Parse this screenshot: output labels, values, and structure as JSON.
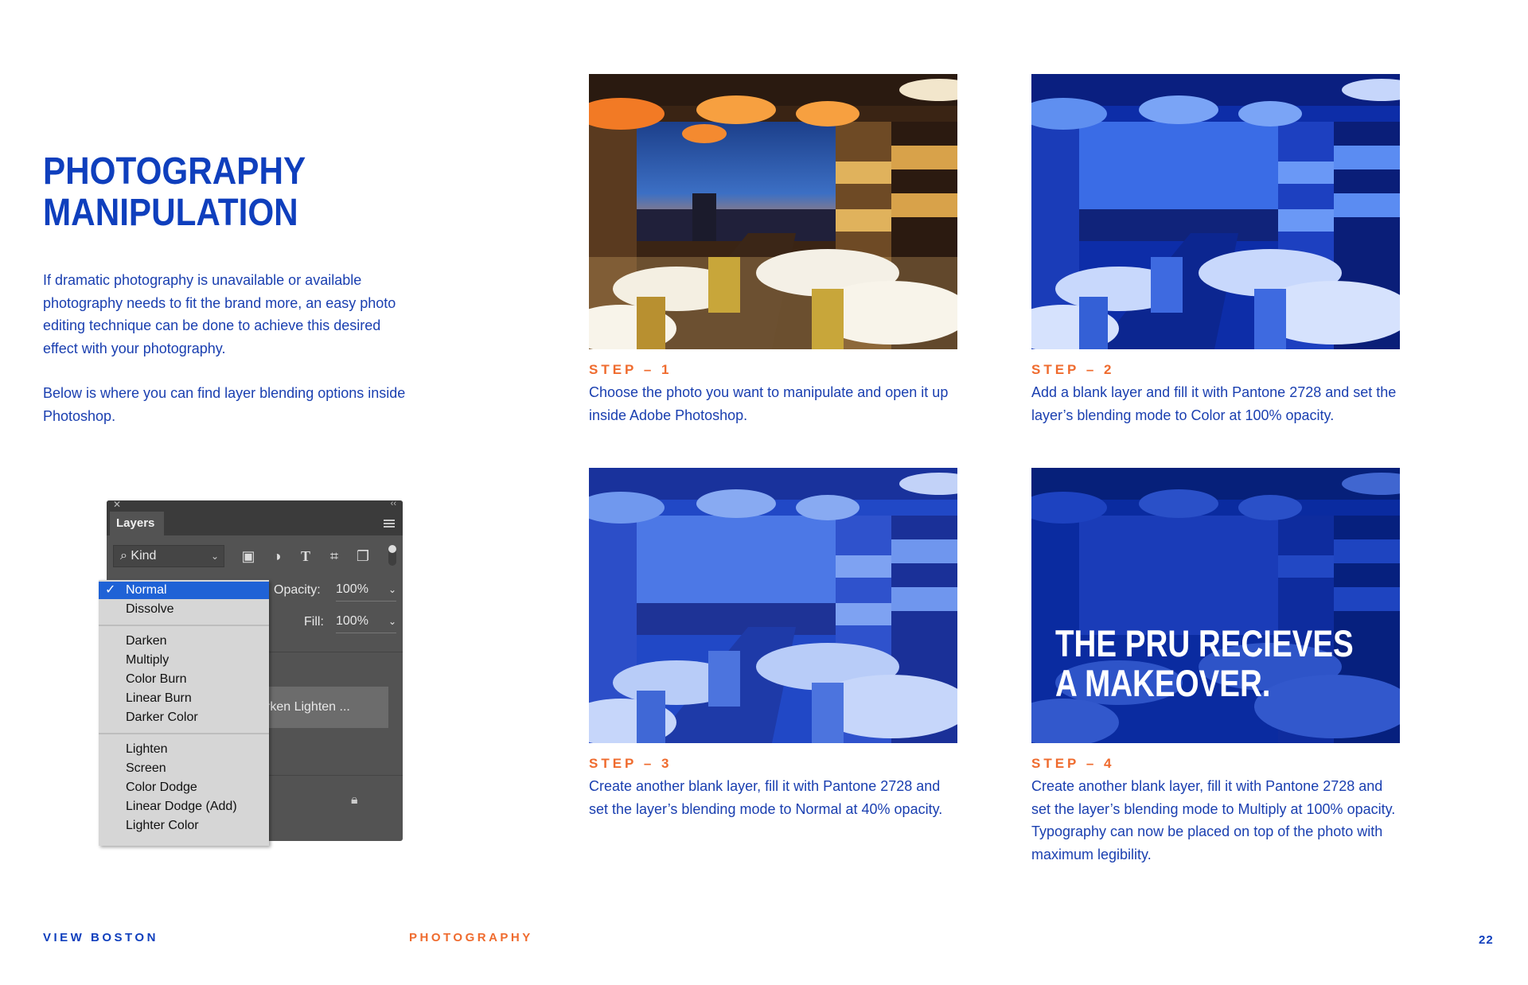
{
  "page": {
    "title_line1": "PHOTOGRAPHY",
    "title_line2": "MANIPULATION",
    "intro_p1": "If dramatic photography is unavailable or available photography needs to fit the brand more, an easy photo editing technique can be done to achieve this desired effect with your photography.",
    "intro_p2": "Below is where you can find layer blending options inside Photoshop."
  },
  "steps": [
    {
      "label": "STEP – 1",
      "text": "Choose the photo you want to manipulate and open it up inside Adobe Photoshop."
    },
    {
      "label": "STEP – 2",
      "text": "Add a blank layer and fill it with Pantone 2728 and set the layer’s blending mode to Color at 100% opacity."
    },
    {
      "label": "STEP – 3",
      "text": "Create another blank layer, fill it with Pantone 2728 and set the layer’s blending mode to Normal at 40% opacity."
    },
    {
      "label": "STEP – 4",
      "text": "Create another blank layer, fill it with Pantone 2728 and set the layer’s blending mode to Multiply at 100% opacity. Typography can now be placed on top of the photo with maximum legibility."
    }
  ],
  "overlay_headline": {
    "line1": "THE PRU RECIEVES",
    "line2": "A MAKEOVER."
  },
  "layers_panel": {
    "tab": "Layers",
    "kind": "Kind",
    "opacity_label": "Opacity:",
    "opacity_value": "100%",
    "fill_label": "Fill:",
    "fill_value": "100%",
    "layer_row_text": "rken   Lighten ...",
    "blend_modes": [
      "Normal",
      "Dissolve",
      "Darken",
      "Multiply",
      "Color Burn",
      "Linear Burn",
      "Darker Color",
      "Lighten",
      "Screen",
      "Color Dodge",
      "Linear Dodge (Add)",
      "Lighter Color"
    ],
    "selected_mode": "Normal"
  },
  "footer": {
    "left": "VIEW BOSTON",
    "center": "PHOTOGRAPHY",
    "page_number": "22"
  },
  "colors": {
    "brand_blue": "#0f3fbd",
    "accent_orange": "#ef6b2e",
    "photoshop_panel": "#535353",
    "selection_blue": "#1f62d6"
  }
}
